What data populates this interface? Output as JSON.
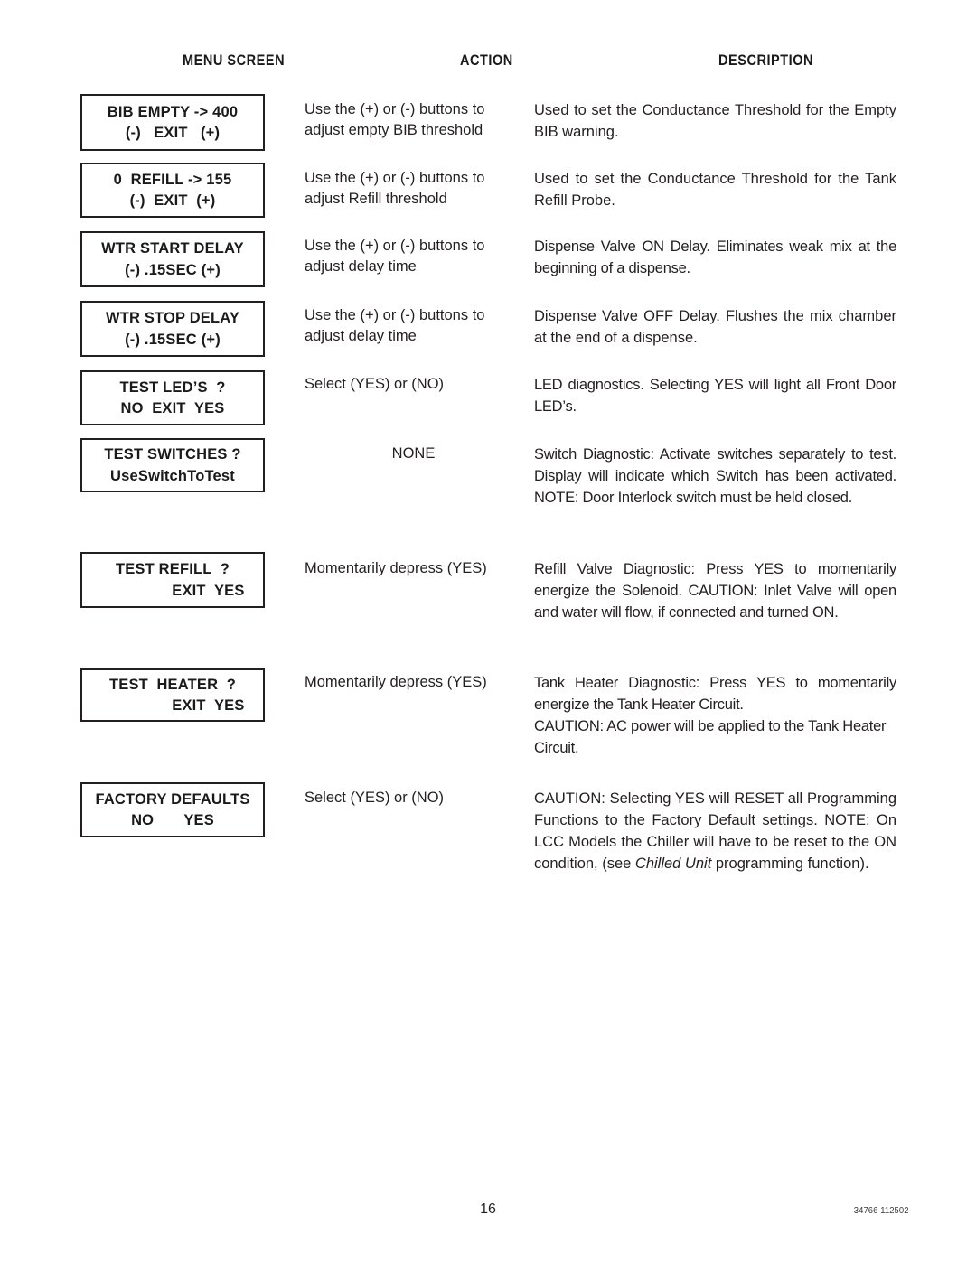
{
  "header": {
    "menu_screen": "MENU SCREEN",
    "action": "ACTION",
    "description": "DESCRIPTION"
  },
  "rows": [
    {
      "lcd_line1": "BIB EMPTY -> 400",
      "lcd_line2": "(-)   EXIT   (+)",
      "action": "Use the (+) or (-) buttons to adjust empty BIB threshold",
      "description": "Used to set the Conductance Threshold for the Empty BIB warning."
    },
    {
      "lcd_line1": "0  REFILL -> 155",
      "lcd_line2": "(-)  EXIT  (+)",
      "action": "Use the (+) or (-) buttons to adjust Refill threshold",
      "description": "Used to set the Conductance Threshold for the Tank Refill Probe."
    },
    {
      "lcd_line1": "WTR START DELAY",
      "lcd_line2": "(-) .15SEC (+)",
      "action": "Use the (+) or (-) buttons to adjust delay time",
      "description": "Dispense Valve ON Delay. Eliminates weak mix at the beginning of a dispense."
    },
    {
      "lcd_line1": "WTR STOP DELAY",
      "lcd_line2": "(-) .15SEC (+)",
      "action": "Use the (+) or (-) buttons to adjust delay time",
      "description": "Dispense Valve OFF Delay. Flushes the mix chamber at the end of a dispense."
    },
    {
      "lcd_line1": "TEST LED’S  ?",
      "lcd_line2": "NO  EXIT  YES",
      "action": "Select (YES) or (NO)",
      "description": "LED diagnostics. Selecting YES will light all Front Door LED’s."
    },
    {
      "lcd_line1": "TEST SWITCHES ?",
      "lcd_line2": "UseSwitchToTest",
      "action": "NONE",
      "description": "Switch Diagnostic: Activate switches separately to test. Display will indicate which Switch has been activated. NOTE: Door Interlock switch must be held closed."
    },
    {
      "lcd_line1": "TEST REFILL  ?",
      "lcd_line2": "EXIT  YES",
      "action": "Momentarily depress (YES)",
      "description": "Refill Valve Diagnostic: Press YES to momentarily energize the Solenoid. CAUTION: Inlet Valve will open and water will flow, if connected and turned ON."
    },
    {
      "lcd_line1": "TEST  HEATER  ?",
      "lcd_line2": "EXIT  YES",
      "action": "Momentarily depress (YES)",
      "description": "Tank Heater Diagnostic: Press YES to momentarily energize the Tank Heater Circuit.",
      "description2": "CAUTION: AC power will be applied to the Tank Heater Circuit."
    },
    {
      "lcd_line1": "FACTORY DEFAULTS",
      "lcd_line2": "NO       YES",
      "action": "Select (YES) or (NO)",
      "description_pre": "CAUTION: Selecting YES will RESET all Programming Functions to the Factory Default settings. NOTE: On LCC Models the Chiller will have to be reset to the ON condition, (see ",
      "description_italic": "Chilled Unit",
      "description_post": " programming function)."
    }
  ],
  "footer": {
    "page_number": "16",
    "doc_code": "34766 112502"
  }
}
